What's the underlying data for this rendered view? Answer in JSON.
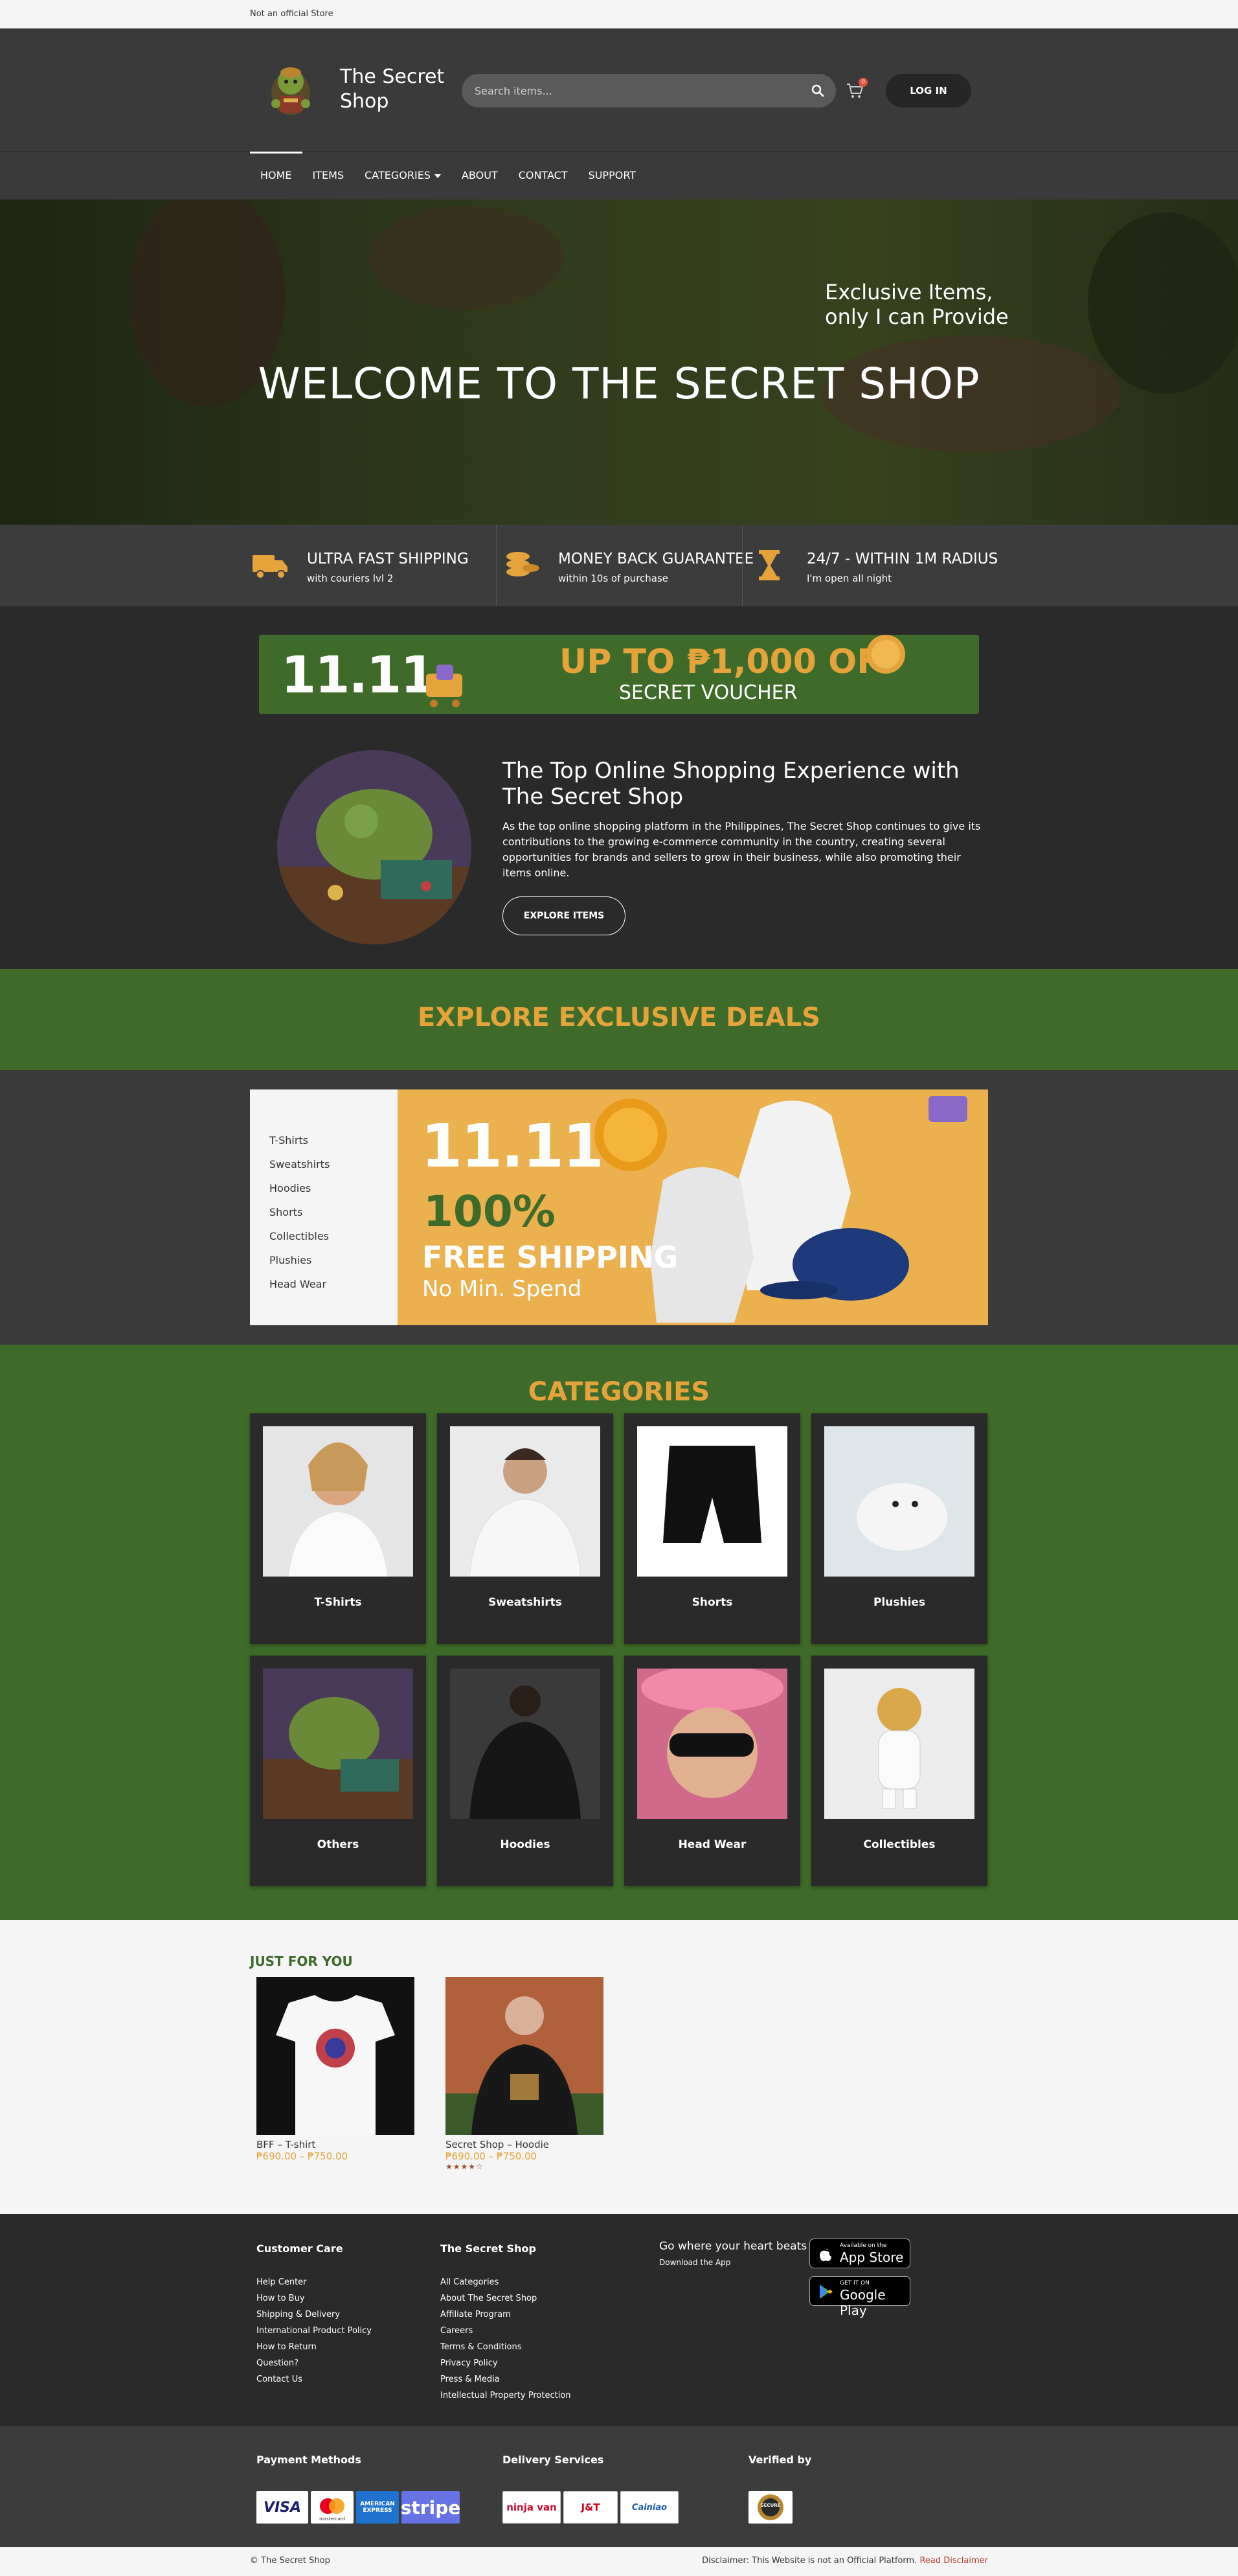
{
  "topbar": {
    "note": "Not an official Store"
  },
  "header": {
    "brand_line1": "The Secret",
    "brand_line2": "Shop",
    "search_placeholder": "Search items...",
    "cart_count": "0",
    "login_label": "LOG IN"
  },
  "nav": {
    "items": [
      "HOME",
      "ITEMS",
      "CATEGORIES",
      "ABOUT",
      "CONTACT",
      "SUPPORT"
    ]
  },
  "hero": {
    "tag_line1": "Exclusive Items,",
    "tag_line2": "only I can Provide",
    "title": "WELCOME TO THE SECRET SHOP"
  },
  "features": [
    {
      "title": "ULTRA FAST SHIPPING",
      "sub": "with couriers lvl 2",
      "icon": "truck-icon"
    },
    {
      "title": "MONEY BACK GUARANTEE",
      "sub": "within 10s of purchase",
      "icon": "coins-icon"
    },
    {
      "title": "24/7 - WITHIN 1M RADIUS",
      "sub": "I'm open all night",
      "icon": "hourglass-icon"
    }
  ],
  "voucher": {
    "date": "11.11",
    "headline": "UP TO ₱1,000 OFF",
    "sub": "SECRET VOUCHER"
  },
  "about": {
    "title": "The Top Online Shopping Experience with The Secret Shop",
    "text": "As the top online shopping platform in the Philippines, The Secret Shop continues to give its contributions to the growing e-commerce community in the country, creating several opportunities for brands and sellers to grow in their business, while also promoting their items online.",
    "button": "EXPLORE ITEMS"
  },
  "deals": {
    "heading": "EXPLORE EXCLUSIVE DEALS",
    "menu": [
      "T-Shirts",
      "Sweatshirts",
      "Hoodies",
      "Shorts",
      "Collectibles",
      "Plushies",
      "Head Wear"
    ],
    "banner": {
      "date": "11.11",
      "percent": "100%",
      "line": "FREE SHIPPING",
      "sub": "No Min. Spend"
    }
  },
  "categories": {
    "heading": "CATEGORIES",
    "items": [
      "T-Shirts",
      "Sweatshirts",
      "Shorts",
      "Plushies",
      "Others",
      "Hoodies",
      "Head Wear",
      "Collectibles"
    ]
  },
  "just_for_you": {
    "heading": "JUST FOR YOU",
    "products": [
      {
        "name": "BFF – T-shirt",
        "price": "₱690.00 – ₱750.00",
        "rating": ""
      },
      {
        "name": "Secret Shop – Hoodie",
        "price": "₱690.00 – ₱750.00",
        "rating": "★★★★☆"
      }
    ]
  },
  "footer": {
    "customer_care": {
      "heading": "Customer Care",
      "links": [
        "Help Center",
        "How to Buy",
        "Shipping & Delivery",
        "International Product Policy",
        "How to Return",
        "Question?",
        "Contact Us"
      ]
    },
    "secret_shop": {
      "heading": "The Secret Shop",
      "links": [
        "All Categories",
        "About The Secret Shop",
        "Affiliate Program",
        "Careers",
        "Terms & Conditions",
        "Privacy Policy",
        "Press & Media",
        "Intellectual Property Protection"
      ]
    },
    "app": {
      "tagline": "Go where your heart beats",
      "sub": "Download the App",
      "appstore_small": "Available on the",
      "appstore_big": "App Store",
      "play_small": "GET IT ON",
      "play_big": "Google Play"
    }
  },
  "footer2": {
    "payment_heading": "Payment Methods",
    "payment_logos": [
      "VISA",
      "mastercard",
      "AMERICAN EXPRESS",
      "stripe"
    ],
    "delivery_heading": "Delivery Services",
    "delivery_logos": [
      "ninja van",
      "J&T",
      "Cainiao"
    ],
    "verified_heading": "Verified by",
    "verified_logo": "SECURE"
  },
  "bottom": {
    "copyright": "© The Secret Shop",
    "disclaimer": "Disclaimer: This Website is not an Official Platform.",
    "disclaimer_link": "Read Disclaimer"
  },
  "colors": {
    "accent_orange": "#e5a33b",
    "green": "#3e6b2a",
    "dark": "#2a2a2a",
    "header": "#3a3a3a"
  }
}
